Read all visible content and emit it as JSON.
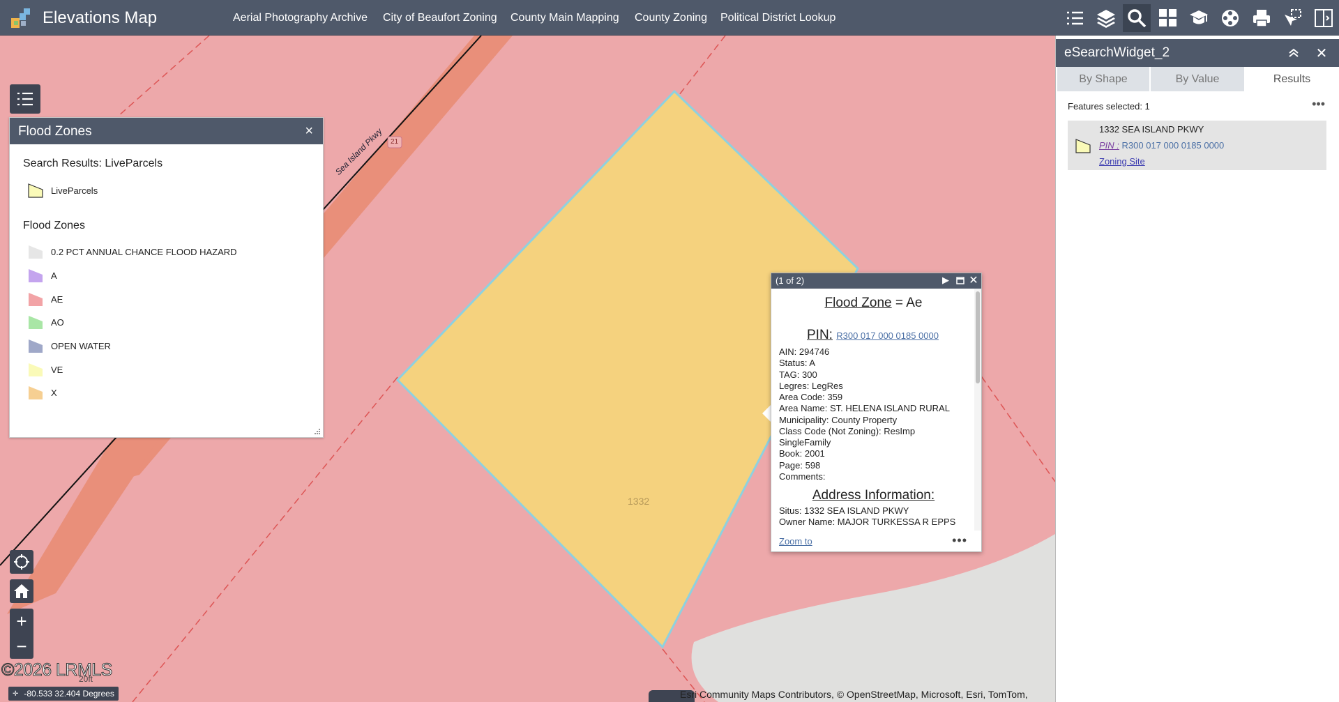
{
  "header": {
    "title": "Elevations Map",
    "links": [
      "Aerial Photography Archive",
      "City of Beaufort Zoning",
      "County Main Mapping",
      "County Zoning",
      "Political District Lookup"
    ],
    "tools": [
      "list-icon",
      "layers-icon",
      "search-icon",
      "grid-icon",
      "education-icon",
      "film-icon",
      "print-icon",
      "select-icon",
      "split-panel-icon"
    ],
    "active_tool": "search-icon"
  },
  "map": {
    "road_label": "Sea Island Pkwy",
    "route_shield": "21",
    "parcel_label": "1332",
    "copyright": "©2026 LRMLS",
    "scale": "20ft",
    "coordinates": "-80.533 32.404 Degrees",
    "attribution": "Esri Community Maps Contributors, © OpenStreetMap, Microsoft, Esri, TomTom,",
    "colors": {
      "background": "#eda8aa",
      "parcel_fill": "#f5d27e",
      "parcel_outline": "#8ed1df",
      "road": "#e98f7a",
      "water": "#e0e0de"
    }
  },
  "legend": {
    "title": "Flood Zones",
    "search_section": "Search Results: LiveParcels",
    "search_item": "LiveParcels",
    "zones_section": "Flood Zones",
    "zones": [
      {
        "label": "0.2 PCT ANNUAL CHANCE FLOOD HAZARD",
        "color": "#e6e6e6"
      },
      {
        "label": "A",
        "color": "#c4a4ee"
      },
      {
        "label": "AE",
        "color": "#f2a3a6"
      },
      {
        "label": "AO",
        "color": "#a9e6a6"
      },
      {
        "label": "OPEN WATER",
        "color": "#9fa8c8"
      },
      {
        "label": "VE",
        "color": "#fafab8"
      },
      {
        "label": "X",
        "color": "#f6cf92"
      }
    ]
  },
  "popup": {
    "counter": "(1 of 2)",
    "flood_zone_label": "Flood Zone",
    "flood_zone_value": "= Ae",
    "pin_label": "PIN:",
    "pin_value": "R300 017 000 0185 0000",
    "fields": [
      "AIN: 294746",
      "Status: A",
      "TAG: 300",
      "Legres: LegRes",
      "Area Code: 359",
      "Area Name: ST. HELENA ISLAND RURAL",
      "Municipality: County Property",
      "Class Code (Not Zoning): ResImp",
      "SingleFamily",
      "Book: 2001",
      "Page: 598",
      "Comments:"
    ],
    "address_title": "Address Information:",
    "address_fields": [
      "Situs: 1332 SEA ISLAND PKWY",
      "Owner Name: MAJOR TURKESSA R EPPS"
    ],
    "zoom_to": "Zoom to"
  },
  "search_widget": {
    "title": "eSearchWidget_2",
    "tabs": [
      "By Shape",
      "By Value",
      "Results"
    ],
    "active_tab": "Results",
    "features_selected": "Features selected: 1",
    "result": {
      "address": "1332 SEA ISLAND PKWY",
      "pin_label": "PIN :",
      "pin_value": " R300 017 000 0185 0000",
      "link": "Zoning Site"
    }
  }
}
